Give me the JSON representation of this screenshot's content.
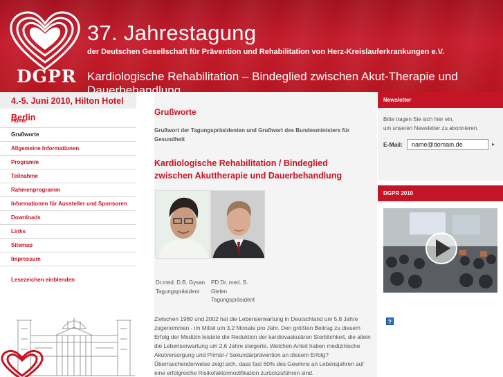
{
  "header": {
    "title": "37. Jahrestagung",
    "subtitle": "der Deutschen Gesellschaft für Prävention und Rehabilitation von Herz-Kreislauferkrankungen e.V.",
    "tagline": "Kardiologische Rehabilitation – Bindeglied zwischen Akut-Therapie und Dauerbehandlung",
    "logo_text": "DGPR",
    "accent": "#c41425"
  },
  "sidebar": {
    "date_location": "4.-5. Juni 2010, Hilton Hotel Berlin",
    "items": [
      {
        "label": "Home"
      },
      {
        "label": "Grußworte"
      },
      {
        "label": "Allgemeine Informationen"
      },
      {
        "label": "Programm"
      },
      {
        "label": "Teilnahme"
      },
      {
        "label": "Rahmenprogramm"
      },
      {
        "label": "Informationen für Aussteller und Sponsoren"
      },
      {
        "label": "Downloads"
      },
      {
        "label": "Links"
      },
      {
        "label": "Sitemap"
      },
      {
        "label": "Impressum"
      }
    ],
    "bookmark": "Lesezeichen einblenden"
  },
  "main": {
    "heading": "Grußworte",
    "description": "Grußwort der Tagungspräsidenten und Grußwort des Bundesministers für Gesundheit",
    "article_title": "Kardiologische Rehabilitation / Bindeglied zwischen Akuttherapie und Dauerbehandlung",
    "caption1_name": "Dr.med. D.B. Gysan",
    "caption1_role": "Tagungspräsident",
    "caption2_name": "PD Dr. med. S.",
    "caption2_name2": "Gielen",
    "caption2_role": "Tagungspräsident",
    "body_text": "Zwischen 1980 und 2002 hat die Lebenserwartung in Deutschland um 5,8 Jahre zugenommen - im Mittel um 3,2 Monate pro Jahr. Den größten Beitrag zu diesem Erfolg der Medizin leistete die Reduktion der kardiovaskulären Sterblichkeit, die allein die Lebenserwartung um 2,6 Jahre steigerte. Welchen Anteil haben medizinische Akutversorgung und Primär-/ Sekundärprävention an diesem Erfolg? Überraschenderweise zeigt sich, dass fast 60% des Gewinns an Lebensjahren auf eine erfolgreiche Risikofaktormodifikation zurückzuführen sind."
  },
  "newsletter": {
    "header": "Newsletter",
    "text1": "Bitte tragen Sie sich hier ein,",
    "text2": "um unseren Newsletter zu abonnieren.",
    "email_label": "E-Mail:",
    "email_placeholder": "name@domain.de",
    "submit_glyph": "▸"
  },
  "video": {
    "header": "DGPR 2010",
    "icon": "play-icon"
  },
  "help": {
    "glyph": "?"
  }
}
